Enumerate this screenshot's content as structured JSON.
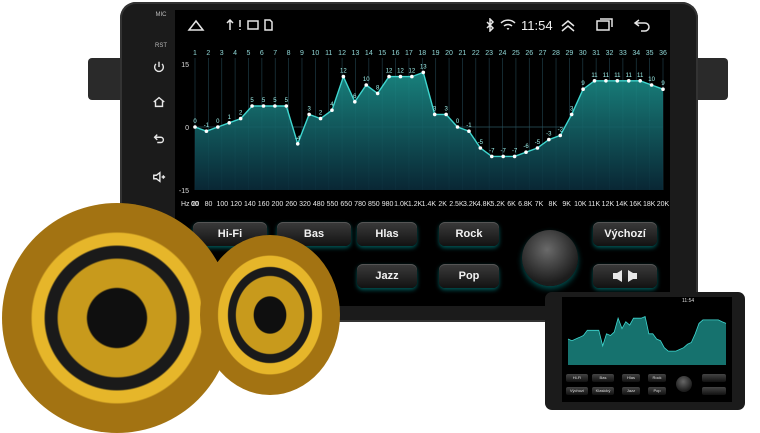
{
  "status_bar": {
    "mic_label": "MIC",
    "rst_label": "RST",
    "time": "11:54"
  },
  "eq": {
    "band_numbers": [
      "1",
      "2",
      "3",
      "4",
      "5",
      "6",
      "7",
      "8",
      "9",
      "10",
      "11",
      "12",
      "13",
      "14",
      "15",
      "16",
      "17",
      "18",
      "19",
      "20",
      "21",
      "22",
      "23",
      "24",
      "25",
      "26",
      "27",
      "28",
      "29",
      "30",
      "31",
      "32",
      "33",
      "34",
      "35",
      "36"
    ],
    "y_max_label": "15",
    "y_zero_label": "0",
    "y_min_label": "-15",
    "freq_labels": [
      "Hz 20",
      "60",
      "80",
      "100",
      "120",
      "140",
      "160",
      "200",
      "260",
      "320",
      "480",
      "550",
      "650",
      "780",
      "850",
      "980",
      "1.0K",
      "1.2K",
      "1.4K",
      "2K",
      "2.5K",
      "3.2K",
      "4.8K",
      "5.2K",
      "6K",
      "6.8K",
      "7K",
      "8K",
      "9K",
      "10K",
      "11K",
      "12K",
      "14K",
      "16K",
      "18K",
      "20K"
    ],
    "values": [
      0,
      -1,
      0,
      1,
      2,
      5,
      5,
      5,
      5,
      -4,
      3,
      2,
      4,
      12,
      6,
      10,
      8,
      12,
      12,
      12,
      13,
      3,
      3,
      0,
      -1,
      -5,
      -7,
      -7,
      -7,
      -6,
      -5,
      -3,
      -2,
      3,
      9,
      11,
      11,
      11,
      11,
      11,
      10,
      9
    ]
  },
  "buttons": {
    "hifi": "Hi-Fi",
    "bas": "Bas",
    "hlas": "Hlas",
    "rock": "Rock",
    "vychozi": "Výchozí",
    "jazz": "Jazz",
    "pop": "Pop"
  },
  "thumbnail": {
    "time": "11:54",
    "btn_vychozi": "Výchozí",
    "btn_klasicky": "Klasický",
    "btn_jazz": "Jazz",
    "btn_pop": "Pop",
    "btn_rock": "Rock",
    "btn_hlas": "Hlas",
    "btn_bas": "Bas",
    "btn_hifi": "Hi-Fi"
  },
  "colors": {
    "curve": "#3fd6cf",
    "fill_top": "#1b8f8a",
    "fill_bottom": "#0a2b3a",
    "gold": "#d8a21a"
  }
}
